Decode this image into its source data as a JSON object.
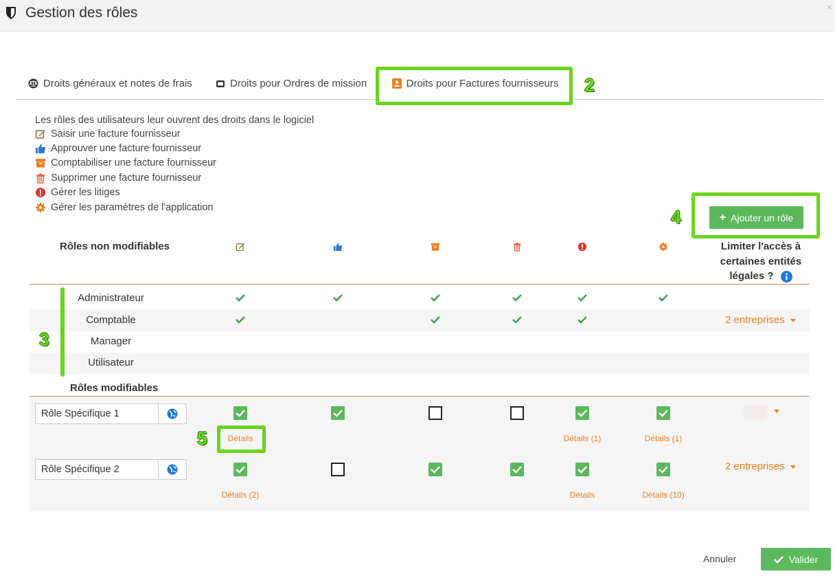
{
  "header": {
    "title": "Gestion des rôles",
    "close": "×"
  },
  "tabs": [
    {
      "label": "Droits généraux et notes de frais",
      "icon": "balance-icon"
    },
    {
      "label": "Droits pour Ordres de mission",
      "icon": "briefcase-icon"
    },
    {
      "label": "Droits pour Factures fournisseurs",
      "icon": "invoice-icon",
      "active": true
    }
  ],
  "legend": {
    "intro": "Les rôles des utilisateurs leur ouvrent des droits dans le logiciel",
    "items": [
      {
        "label": "Saisir une facture fournisseur",
        "icon": "edit-icon",
        "color": "#8a6d3b"
      },
      {
        "label": "Approuver une facture fournisseur",
        "icon": "thumbs-up-icon",
        "color": "#2a7ad2"
      },
      {
        "label": "Comptabiliser une facture fournisseur",
        "icon": "archive-icon",
        "color": "#ef7d22"
      },
      {
        "label": "Supprimer une facture fournisseur",
        "icon": "trash-icon",
        "color": "#e25a3c"
      },
      {
        "label": "Gérer les litiges",
        "icon": "exclamation-icon",
        "color": "#d9362b"
      },
      {
        "label": "Gérer les paramètres de l'application",
        "icon": "gear-icon",
        "color": "#ef7d22"
      }
    ]
  },
  "add_role_button": "Ajouter un rôle",
  "table": {
    "fixed_header": "Rôles non modifiables",
    "limit_header": "Limiter l'accès à certaines entités légales ?",
    "fixed_roles": [
      {
        "name": "Administrateur",
        "rights": [
          true,
          true,
          true,
          true,
          true,
          true
        ],
        "entities": ""
      },
      {
        "name": "Comptable",
        "rights": [
          true,
          false,
          true,
          true,
          true,
          false
        ],
        "entities": "2 entreprises"
      },
      {
        "name": "Manager",
        "rights": [
          false,
          false,
          false,
          false,
          false,
          false
        ],
        "entities": ""
      },
      {
        "name": "Utilisateur",
        "rights": [
          false,
          false,
          false,
          false,
          false,
          false
        ],
        "entities": ""
      }
    ],
    "editable_header": "Rôles modifiables",
    "editable_roles": [
      {
        "name": "Rôle Spécifique 1",
        "rights": [
          true,
          true,
          false,
          false,
          true,
          true
        ],
        "details": [
          "Détails",
          "",
          "",
          "",
          "Détails (1)",
          "Détails (1)"
        ],
        "entities": ""
      },
      {
        "name": "Rôle Spécifique 2",
        "rights": [
          true,
          false,
          true,
          true,
          true,
          true
        ],
        "details": [
          "Détails (2)",
          "",
          "",
          "",
          "Détails",
          "Détails (10)"
        ],
        "entities": "2 entreprises"
      }
    ]
  },
  "annotations": [
    "2",
    "3",
    "4",
    "5"
  ],
  "footer": {
    "cancel": "Annuler",
    "submit": "Valider"
  },
  "colors": {
    "accent_green": "#5cb85c",
    "highlight_green": "#6ad41c",
    "orange": "#ef7d22"
  }
}
